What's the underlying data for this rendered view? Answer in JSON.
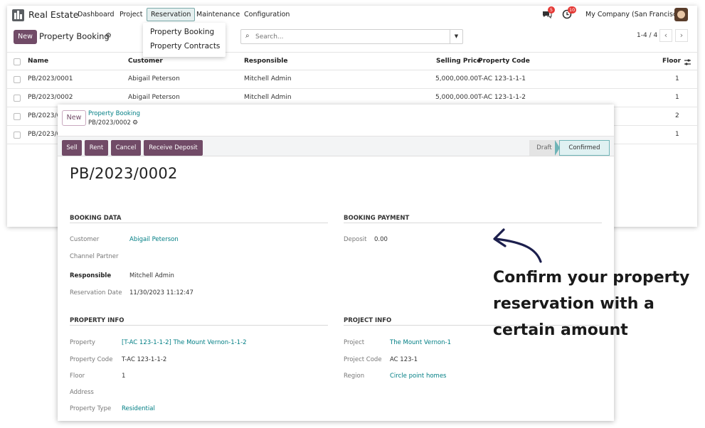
{
  "navbar": {
    "app_name": "Real Estate",
    "menu": [
      "Dashboard",
      "Project",
      "Reservation",
      "Maintenance",
      "Configuration"
    ],
    "messages_count": "5",
    "activities_count": "10",
    "company": "My Company (San Francisco)"
  },
  "reservation_menu": [
    "Property Booking",
    "Property Contracts"
  ],
  "control": {
    "new_label": "New",
    "title": "Property Booking",
    "search_placeholder": "Search...",
    "pager": "1-4 / 4"
  },
  "list": {
    "columns": [
      "Name",
      "Customer",
      "Responsible",
      "Selling Price",
      "Property Code",
      "Floor"
    ],
    "rows": [
      {
        "name": "PB/2023/0001",
        "customer": "Abigail Peterson",
        "responsible": "Mitchell Admin",
        "price": "5,000,000.00",
        "code": "T-AC 123-1-1-1",
        "floor": "1"
      },
      {
        "name": "PB/2023/0002",
        "customer": "Abigail Peterson",
        "responsible": "Mitchell Admin",
        "price": "5,000,000.00",
        "code": "T-AC 123-1-1-2",
        "floor": "1"
      },
      {
        "name": "PB/2023/0",
        "floor": "2"
      },
      {
        "name": "PB/2023/0",
        "floor": "1"
      }
    ]
  },
  "form": {
    "new_label": "New",
    "breadcrumb_parent": "Property Booking",
    "breadcrumb_record": "PB/2023/0002",
    "actions": [
      "Sell",
      "Rent",
      "Cancel",
      "Receive Deposit"
    ],
    "stages": [
      "Draft",
      "Confirmed"
    ],
    "active_stage": "Confirmed",
    "record_name": "PB/2023/0002",
    "booking_data": {
      "title": "BOOKING DATA",
      "customer_label": "Customer",
      "customer": "Abigail Peterson",
      "channel_label": "Channel Partner",
      "responsible_label": "Responsible",
      "responsible": "Mitchell Admin",
      "date_label": "Reservation Date",
      "date": "11/30/2023 11:12:47"
    },
    "booking_payment": {
      "title": "BOOKING PAYMENT",
      "deposit_label": "Deposit",
      "deposit": "0.00"
    },
    "property_info": {
      "title": "PROPERTY INFO",
      "property_label": "Property",
      "property": "[T-AC 123-1-1-2] The Mount Vernon-1-1-2",
      "code_label": "Property Code",
      "code": "T-AC 123-1-1-2",
      "floor_label": "Floor",
      "floor": "1",
      "address_label": "Address",
      "type_label": "Property Type",
      "type": "Residential"
    },
    "project_info": {
      "title": "PROJECT INFO",
      "project_label": "Project",
      "project": "The Mount Vernon-1",
      "code_label": "Project Code",
      "code": "AC 123-1",
      "region_label": "Region",
      "region": "Circle point homes"
    }
  },
  "annotation": {
    "line1": "Confirm your property",
    "line2": "reservation with a",
    "line3": "certain amount"
  },
  "colors": {
    "primary": "#714b67",
    "link": "#017e84",
    "annotation": "#1c1f4d"
  }
}
